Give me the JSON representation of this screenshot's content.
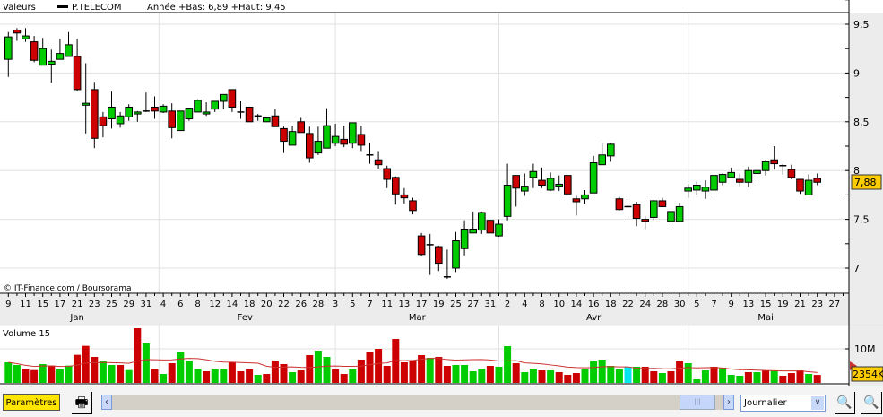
{
  "header": {
    "label": "Valeurs",
    "series": "P.TELECOM",
    "info": "Année +Bas: 6,89 +Haut: 9,45"
  },
  "copyright": "© IT-Finance.com / Boursorama",
  "last_price": "7,88",
  "volume_title": "Volume 15",
  "volume_last": "2354K",
  "toolbar": {
    "params": "Paramètres",
    "period": "Journalier",
    "scroll_left": "‹",
    "scroll_right": "›"
  },
  "colors": {
    "up": "#00cc00",
    "down": "#cc0000",
    "highlight": "#00e5ee",
    "ma": "#cc3333",
    "price_tag": "#ffcc00"
  },
  "chart_data": [
    {
      "type": "candlestick",
      "ylim": [
        6.75,
        9.7
      ],
      "yticks": [
        "9,5",
        "9",
        "8,5",
        "8",
        "7,5",
        "7"
      ],
      "ytick_values": [
        9.5,
        9,
        8.5,
        8,
        7.5,
        7
      ],
      "grid": true,
      "x_tick_labels": [
        "9",
        "11",
        "15",
        "17",
        "21",
        "23",
        "25",
        "29",
        "31",
        "4",
        "6",
        "8",
        "12",
        "14",
        "18",
        "20",
        "22",
        "26",
        "28",
        "3",
        "5",
        "7",
        "11",
        "13",
        "17",
        "19",
        "25",
        "27",
        "31",
        "2",
        "4",
        "8",
        "10",
        "14",
        "16",
        "18",
        "22",
        "24",
        "28",
        "30",
        "5",
        "7",
        "9",
        "13",
        "15",
        "19",
        "21",
        "23",
        "27"
      ],
      "months": [
        {
          "label": "Jan",
          "at": 8
        },
        {
          "label": "Fev",
          "at": 27.5
        },
        {
          "label": "Mar",
          "at": 47.5
        },
        {
          "label": "Avr",
          "at": 68
        },
        {
          "label": "Mai",
          "at": 88
        }
      ],
      "month_starts": [
        17.5,
        38,
        57,
        79
      ],
      "ohlc": [
        [
          9.14,
          9.42,
          8.96,
          9.37
        ],
        [
          9.44,
          9.46,
          9.33,
          9.41
        ],
        [
          9.35,
          9.46,
          9.32,
          9.38
        ],
        [
          9.32,
          9.38,
          9.11,
          9.13
        ],
        [
          9.08,
          9.36,
          9.08,
          9.25
        ],
        [
          9.09,
          9.24,
          8.9,
          9.12
        ],
        [
          9.14,
          9.35,
          9.14,
          9.2
        ],
        [
          9.17,
          9.42,
          9.17,
          9.29
        ],
        [
          9.17,
          9.35,
          8.81,
          8.83
        ],
        [
          8.67,
          9.1,
          8.38,
          8.69
        ],
        [
          8.83,
          8.91,
          8.23,
          8.33
        ],
        [
          8.55,
          8.6,
          8.34,
          8.46
        ],
        [
          8.53,
          8.81,
          8.43,
          8.65
        ],
        [
          8.48,
          8.6,
          8.44,
          8.56
        ],
        [
          8.55,
          8.68,
          8.51,
          8.65
        ],
        [
          8.58,
          8.61,
          8.5,
          8.6
        ],
        [
          8.61,
          8.8,
          8.6,
          8.61
        ],
        [
          8.65,
          8.76,
          8.53,
          8.61
        ],
        [
          8.6,
          8.68,
          8.59,
          8.66
        ],
        [
          8.61,
          8.69,
          8.33,
          8.44
        ],
        [
          8.41,
          8.61,
          8.41,
          8.61
        ],
        [
          8.53,
          8.64,
          8.51,
          8.64
        ],
        [
          8.6,
          8.73,
          8.6,
          8.72
        ],
        [
          8.58,
          8.7,
          8.56,
          8.6
        ],
        [
          8.63,
          8.71,
          8.6,
          8.71
        ],
        [
          8.71,
          8.78,
          8.63,
          8.78
        ],
        [
          8.83,
          8.83,
          8.6,
          8.65
        ],
        [
          8.6,
          8.71,
          8.53,
          8.6
        ],
        [
          8.65,
          8.65,
          8.5,
          8.5
        ],
        [
          8.56,
          8.58,
          8.51,
          8.55
        ],
        [
          8.5,
          8.55,
          8.5,
          8.54
        ],
        [
          8.56,
          8.63,
          8.45,
          8.45
        ],
        [
          8.43,
          8.45,
          8.18,
          8.3
        ],
        [
          8.26,
          8.46,
          8.26,
          8.4
        ],
        [
          8.5,
          8.54,
          8.39,
          8.39
        ],
        [
          8.38,
          8.45,
          8.08,
          8.13
        ],
        [
          8.18,
          8.45,
          8.16,
          8.3
        ],
        [
          8.23,
          8.64,
          8.23,
          8.46
        ],
        [
          8.28,
          8.48,
          8.25,
          8.35
        ],
        [
          8.32,
          8.46,
          8.24,
          8.27
        ],
        [
          8.28,
          8.49,
          8.23,
          8.49
        ],
        [
          8.37,
          8.46,
          8.2,
          8.26
        ],
        [
          8.16,
          8.28,
          8.07,
          8.15
        ],
        [
          8.11,
          8.2,
          8.02,
          8.06
        ],
        [
          8.02,
          8.05,
          7.82,
          7.91
        ],
        [
          7.93,
          7.94,
          7.65,
          7.76
        ],
        [
          7.75,
          7.82,
          7.66,
          7.72
        ],
        [
          7.69,
          7.72,
          7.55,
          7.59
        ],
        [
          7.33,
          7.36,
          7.12,
          7.14
        ],
        [
          7.23,
          7.35,
          6.93,
          7.24
        ],
        [
          7.22,
          7.23,
          6.97,
          7.05
        ],
        [
          6.91,
          7.19,
          6.89,
          6.9
        ],
        [
          7.0,
          7.37,
          6.96,
          7.28
        ],
        [
          7.2,
          7.49,
          7.13,
          7.4
        ],
        [
          7.36,
          7.58,
          7.36,
          7.4
        ],
        [
          7.39,
          7.58,
          7.35,
          7.57
        ],
        [
          7.49,
          7.49,
          7.36,
          7.36
        ],
        [
          7.33,
          7.5,
          7.32,
          7.45
        ],
        [
          7.53,
          8.07,
          7.49,
          7.85
        ],
        [
          7.95,
          7.95,
          7.63,
          7.82
        ],
        [
          7.79,
          7.97,
          7.74,
          7.84
        ],
        [
          7.93,
          8.07,
          7.82,
          7.99
        ],
        [
          7.9,
          8.03,
          7.82,
          7.85
        ],
        [
          7.8,
          7.98,
          7.79,
          7.92
        ],
        [
          7.84,
          7.95,
          7.79,
          7.86
        ],
        [
          7.95,
          7.95,
          7.76,
          7.76
        ],
        [
          7.71,
          7.74,
          7.54,
          7.68
        ],
        [
          7.71,
          7.8,
          7.66,
          7.75
        ],
        [
          7.77,
          8.15,
          7.77,
          8.08
        ],
        [
          8.06,
          8.28,
          8.06,
          8.16
        ],
        [
          8.15,
          8.28,
          8.09,
          8.27
        ],
        [
          7.71,
          7.73,
          7.59,
          7.6
        ],
        [
          7.63,
          7.71,
          7.48,
          7.63
        ],
        [
          7.65,
          7.68,
          7.43,
          7.51
        ],
        [
          7.5,
          7.53,
          7.4,
          7.48
        ],
        [
          7.52,
          7.7,
          7.49,
          7.69
        ],
        [
          7.69,
          7.72,
          7.63,
          7.63
        ],
        [
          7.48,
          7.61,
          7.46,
          7.58
        ],
        [
          7.48,
          7.67,
          7.48,
          7.63
        ],
        [
          7.79,
          7.86,
          7.72,
          7.82
        ],
        [
          7.8,
          7.89,
          7.75,
          7.85
        ],
        [
          7.79,
          7.9,
          7.71,
          7.83
        ],
        [
          7.8,
          7.98,
          7.74,
          7.95
        ],
        [
          7.88,
          7.97,
          7.85,
          7.96
        ],
        [
          7.93,
          8.03,
          7.93,
          7.98
        ],
        [
          7.91,
          7.97,
          7.84,
          7.88
        ],
        [
          7.88,
          8.04,
          7.83,
          8.0
        ],
        [
          7.97,
          8.0,
          7.89,
          8.0
        ],
        [
          8.0,
          8.11,
          7.95,
          8.09
        ],
        [
          8.11,
          8.25,
          8.01,
          8.07
        ],
        [
          8.05,
          8.07,
          7.96,
          8.05
        ],
        [
          8.01,
          8.06,
          7.91,
          7.93
        ],
        [
          7.91,
          7.91,
          7.76,
          7.79
        ],
        [
          7.75,
          7.96,
          7.75,
          7.9
        ],
        [
          7.92,
          7.97,
          7.85,
          7.88
        ]
      ]
    },
    {
      "type": "bar",
      "title": "Volume 15",
      "unit": "M",
      "ylim": [
        0,
        11
      ],
      "yticks": [
        "10M"
      ],
      "ytick_values": [
        10
      ],
      "ma_period": 15,
      "values": [
        6.05,
        5.26,
        4.21,
        3.77,
        5.53,
        5.09,
        3.95,
        5.09,
        8.25,
        10.88,
        7.63,
        6.32,
        5.26,
        5.26,
        3.77,
        16.05,
        11.58,
        3.95,
        2.63,
        5.79,
        8.95,
        6.58,
        4.21,
        3.42,
        3.95,
        3.95,
        6.05,
        3.42,
        3.95,
        2.37,
        2.63,
        6.58,
        5.53,
        3.16,
        3.68,
        8.16,
        9.47,
        7.63,
        3.95,
        2.63,
        3.95,
        6.84,
        9.21,
        10.0,
        5.0,
        12.89,
        6.05,
        6.58,
        8.16,
        7.37,
        7.63,
        5.0,
        5.26,
        5.26,
        3.42,
        4.21,
        5.0,
        4.74,
        10.79,
        5.79,
        3.16,
        4.21,
        3.68,
        3.68,
        3.16,
        2.37,
        2.89,
        4.21,
        6.32,
        6.84,
        5.0,
        3.95,
        4.74,
        4.74,
        4.74,
        3.42,
        2.89,
        3.42,
        6.32,
        5.79,
        1.05,
        3.68,
        4.74,
        4.47,
        2.37,
        2.11,
        3.16,
        3.16,
        3.68,
        3.68,
        2.11,
        2.89,
        3.68,
        2.63,
        2.35
      ],
      "dir": "ggrrgrggrrrggrgrgrgrgggrggrrrgrrrgrrggrrgrrrrrrrrgrrggggrggrggrgrrrgggggcgrrgrrgggrgggrgrgrrrgr"
    }
  ]
}
